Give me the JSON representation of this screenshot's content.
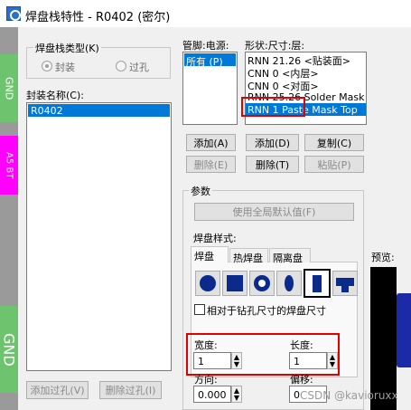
{
  "window": {
    "title": "焊盘栈特性 - R0402 (密尔)"
  },
  "left_strip": {
    "top_label": "GND",
    "mid_label": "A5 BT",
    "bottom_label": "GND"
  },
  "pad_stack_type": {
    "label": "焊盘栈类型(K)",
    "options": [
      {
        "label": "封装",
        "selected": true
      },
      {
        "label": "过孔",
        "selected": false
      }
    ]
  },
  "package_name": {
    "label": "封装名称(C):",
    "items": [
      "R0402"
    ]
  },
  "pins": {
    "label": "管脚:电源:",
    "items": [
      "所有 (P)"
    ],
    "add_label": "添加(A)",
    "delete_label": "删除(E)"
  },
  "shape_layers": {
    "label": "形状:尺寸:层:",
    "items": [
      "RNN 21.26 <贴装面>",
      "CNN 0 <内层>",
      "CNN 0 <对面>",
      "RNN 25.26 Solder Mask Top",
      "RNN 1 Paste Mask Top"
    ],
    "add_label": "添加(D)",
    "copy_label": "复制(C)",
    "delete_label": "删除(T)",
    "paste_label": "粘贴(P)"
  },
  "params": {
    "label": "参数",
    "use_defaults_label": "使用全局默认值(F)",
    "pad_style_label": "焊盘样式:",
    "tabs": [
      "焊盘",
      "热焊盘",
      "隔离盘"
    ],
    "shape_icons": [
      "circle-shape-icon",
      "square-shape-icon",
      "annular-shape-icon",
      "oval-shape-icon",
      "rectangle-shape-icon",
      "custom-shape-icon"
    ],
    "relative_checkbox_label": "相对于钻孔尺寸的焊盘尺寸",
    "width_label": "宽度:",
    "width_value": "1",
    "length_label": "长度:",
    "length_value": "1",
    "direction_label": "方向:",
    "direction_value": "0.000",
    "offset_label": "偏移:",
    "offset_value": "0"
  },
  "preview_label": "预览:",
  "add_via_label": "添加过孔(V)",
  "delete_via_label": "删除过孔(I)",
  "watermark": "CSDN @kavioruxx",
  "colors": {
    "selection": "#0078d7",
    "highlight": "#e00000",
    "shape_fill": "#0a2a8c"
  }
}
